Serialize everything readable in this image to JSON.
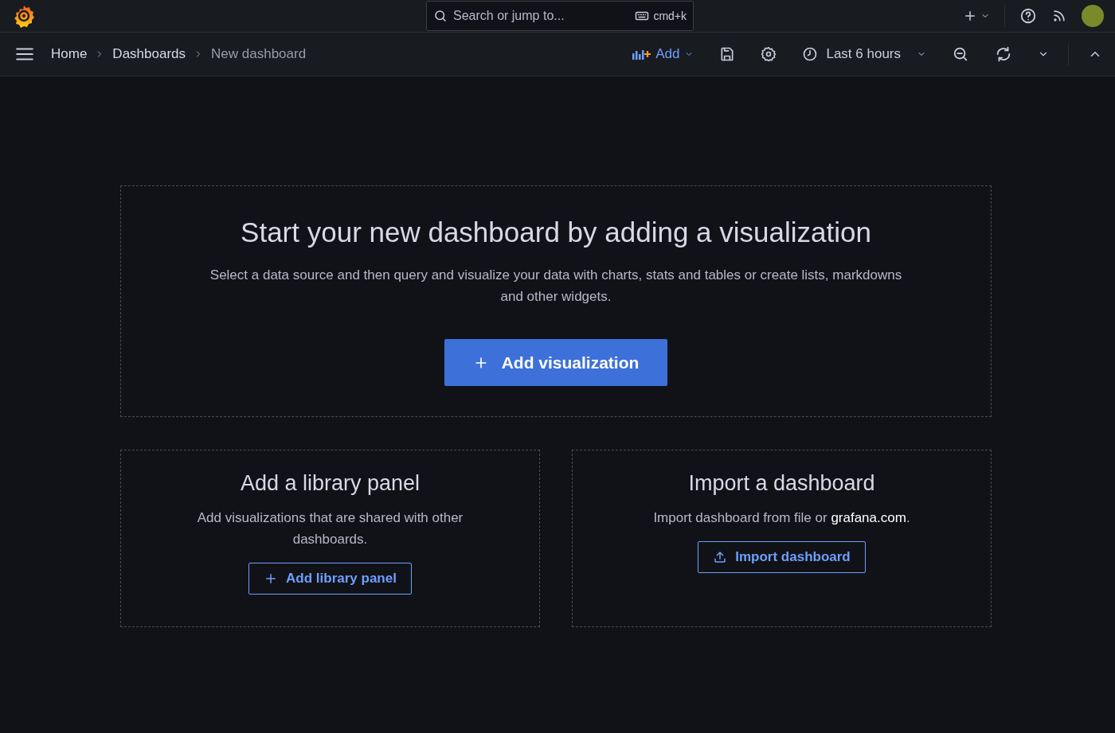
{
  "topbar": {
    "search": {
      "placeholder": "Search or jump to...",
      "shortcut": "cmd+k"
    }
  },
  "breadcrumbs": [
    {
      "label": "Home",
      "current": false
    },
    {
      "label": "Dashboards",
      "current": false
    },
    {
      "label": "New dashboard",
      "current": true
    }
  ],
  "toolbar": {
    "add_label": "Add",
    "time_range": "Last 6 hours"
  },
  "hero": {
    "title": "Start your new dashboard by adding a visualization",
    "description": "Select a data source and then query and visualize your data with charts, stats and tables or create lists, markdowns and other widgets.",
    "button": "Add visualization"
  },
  "cards": [
    {
      "kind": "library",
      "title": "Add a library panel",
      "description": "Add visualizations that are shared with other dashboards.",
      "button": "Add library panel"
    },
    {
      "kind": "import",
      "title": "Import a dashboard",
      "description": "Import dashboard from file or ",
      "link": "grafana.com",
      "description_end": ".",
      "button": "Import dashboard"
    }
  ]
}
